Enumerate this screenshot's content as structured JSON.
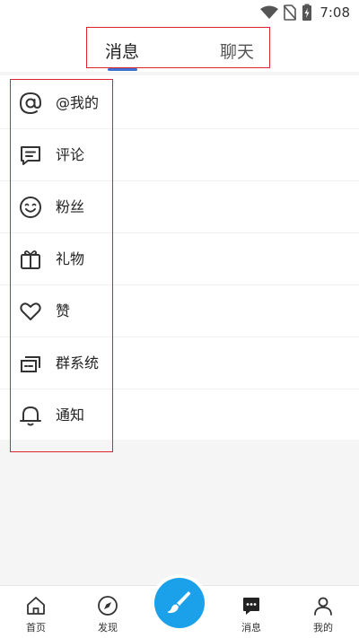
{
  "status_bar": {
    "time": "7:08"
  },
  "header": {
    "tabs": [
      {
        "label": "消息",
        "active": true
      },
      {
        "label": "聊天",
        "active": false
      }
    ]
  },
  "menu": {
    "items": [
      {
        "label": "@我的",
        "icon": "at-icon"
      },
      {
        "label": "评论",
        "icon": "comment-icon"
      },
      {
        "label": "粉丝",
        "icon": "smile-icon"
      },
      {
        "label": "礼物",
        "icon": "gift-icon"
      },
      {
        "label": "赞",
        "icon": "heart-icon"
      },
      {
        "label": "群系统",
        "icon": "group-icon"
      },
      {
        "label": "通知",
        "icon": "bell-icon"
      }
    ]
  },
  "bottom_nav": {
    "items": [
      {
        "label": "首页",
        "icon": "home-icon"
      },
      {
        "label": "发现",
        "icon": "compass-icon"
      },
      {
        "label": "消息",
        "icon": "message-icon",
        "active": true
      },
      {
        "label": "我的",
        "icon": "person-icon"
      }
    ],
    "fab_icon": "brush-icon"
  },
  "colors": {
    "accent": "#3b6fd1",
    "fab": "#1aa1ea",
    "highlight_box": "#d9252b"
  }
}
